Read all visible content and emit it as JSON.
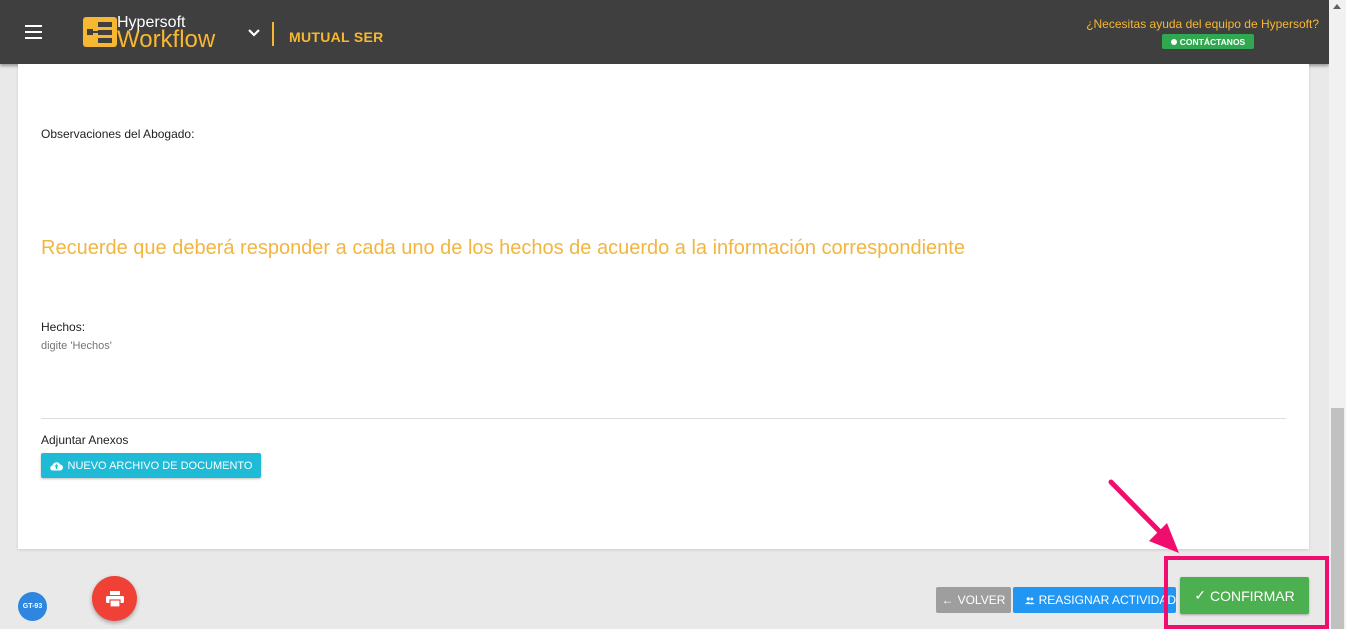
{
  "header": {
    "brand_top": "Hypersoft",
    "brand_main": "Workflow",
    "company": "MUTUAL SER",
    "help_text": "¿Necesitas ayuda del equipo de Hypersoft?",
    "contact_label": "CONTÁCTANOS"
  },
  "form": {
    "observaciones_label": "Observaciones del Abogado:",
    "reminder": "Recuerde que deberá responder a cada uno de los hechos de acuerdo a la información correspondiente",
    "hechos_label": "Hechos:",
    "hechos_placeholder": "digite 'Hechos'",
    "anexos_label": "Adjuntar Anexos",
    "upload_label": "NUEVO ARCHIVO DE DOCUMENTO"
  },
  "footer": {
    "badge": "GT-93",
    "back_label": "VOLVER",
    "reassign_label": "REASIGNAR ACTIVIDAD",
    "confirm_label": "CONFIRMAR"
  },
  "colors": {
    "accent": "#f7b731",
    "highlight": "#f00d6e",
    "confirm": "#4caf50"
  }
}
